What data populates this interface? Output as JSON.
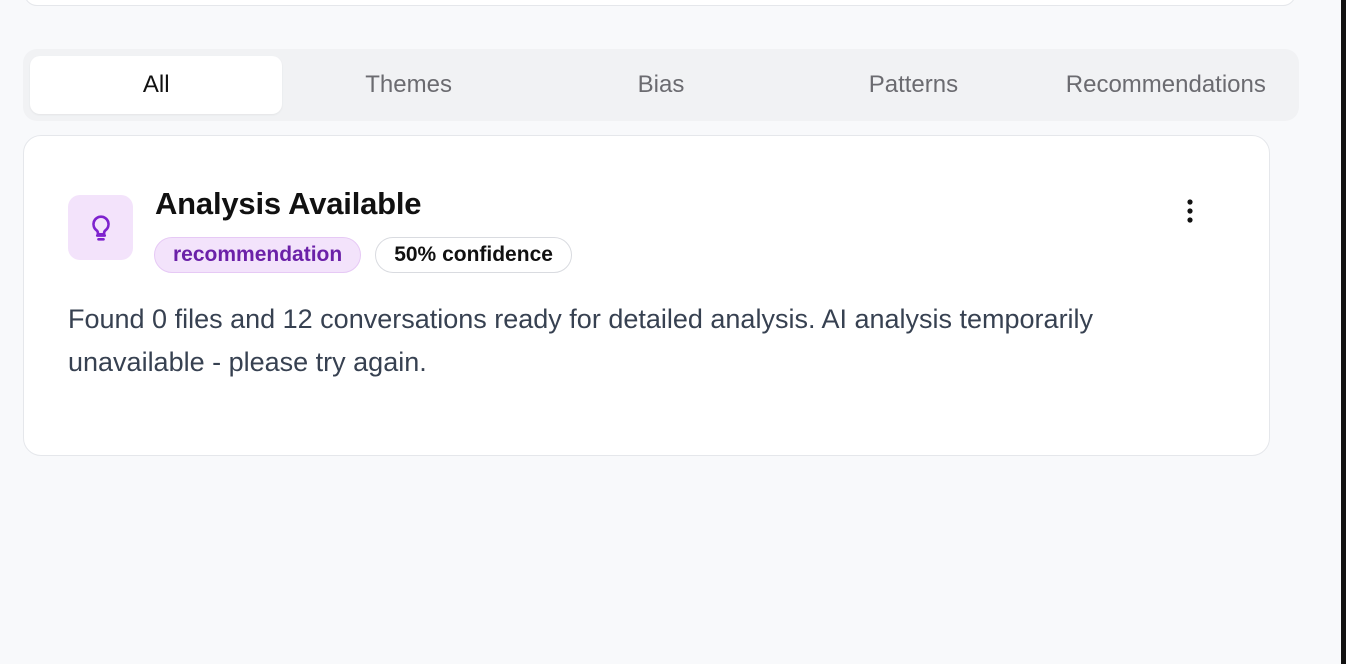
{
  "tabs": [
    {
      "label": "All",
      "active": true
    },
    {
      "label": "Themes",
      "active": false
    },
    {
      "label": "Bias",
      "active": false
    },
    {
      "label": "Patterns",
      "active": false
    },
    {
      "label": "Recommendations",
      "active": false
    }
  ],
  "insight": {
    "icon": "lightbulb-icon",
    "title": "Analysis Available",
    "type_badge": "recommendation",
    "confidence_badge": "50% confidence",
    "description": "Found 0 files and 12 conversations ready for detailed analysis. AI analysis temporarily unavailable - please try again.",
    "menu_icon": "more-vertical-icon"
  },
  "colors": {
    "accent": "#7e22ce",
    "accent_soft": "#f3e3fb",
    "page_background": "#f8f9fb"
  }
}
